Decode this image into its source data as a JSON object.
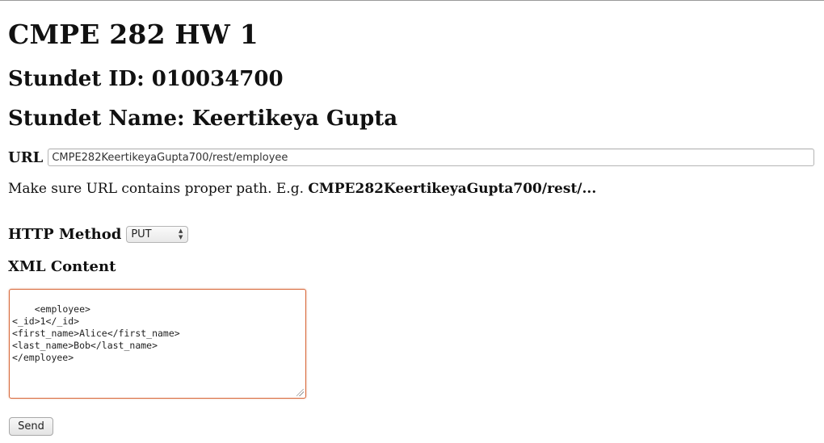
{
  "page": {
    "title": "CMPE 282 HW 1",
    "student_id": "Stundet ID: 010034700",
    "student_name": "Stundet Name: Keertikeya Gupta"
  },
  "url": {
    "label": "URL",
    "value": "CMPE282KeertikeyaGupta700/rest/employee"
  },
  "hint": {
    "text": "Make sure URL contains proper path. E.g. ",
    "example": "CMPE282KeertikeyaGupta700/rest/..."
  },
  "http_method": {
    "label": "HTTP Method",
    "selected": "PUT"
  },
  "xml": {
    "label": "XML Content",
    "content": "<employee>\n<_id>1</_id>\n<first_name>Alice</first_name>\n<last_name>Bob</last_name>\n</employee>",
    "focus_color": "#d8693b"
  },
  "send": {
    "label": "Send"
  }
}
